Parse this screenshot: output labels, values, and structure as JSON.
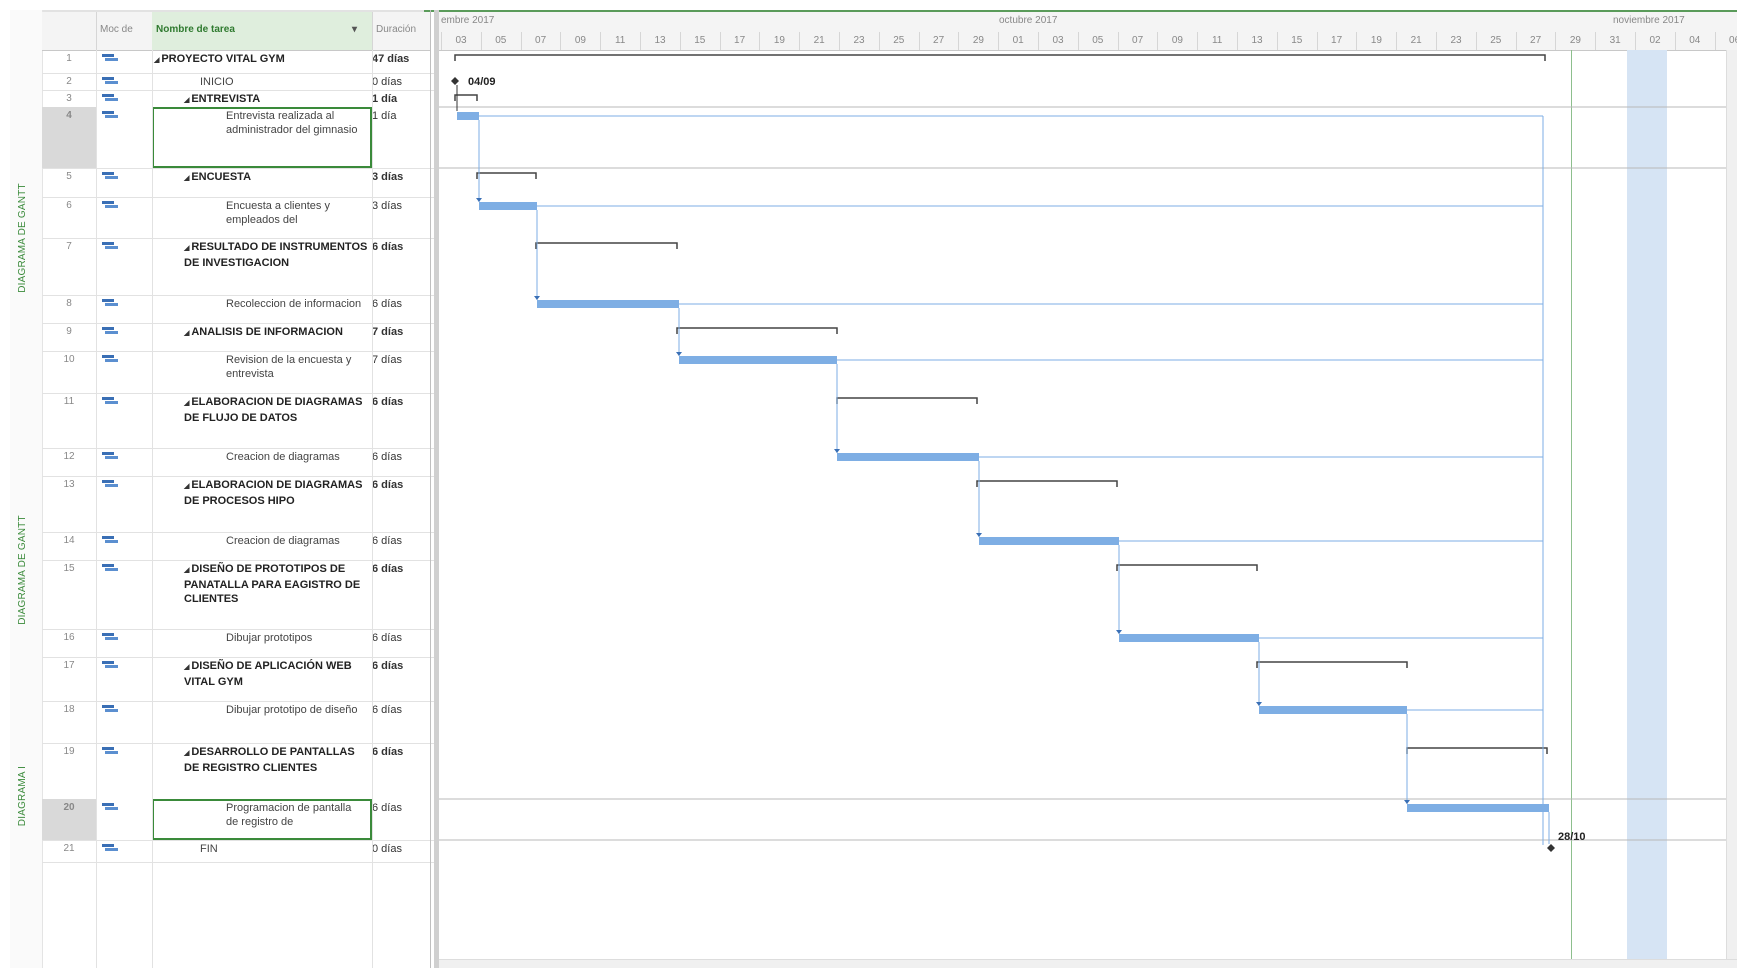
{
  "colors": {
    "accent": "#3a8a3a",
    "bar": "#7eaee4",
    "link": "#7eaee4",
    "highlight": "#d6e4f4"
  },
  "side_labels": [
    "DIAGRAMA DE GANTT",
    "DIAGRAMA DE GANTT",
    "DIAGRAMA I"
  ],
  "columns": {
    "mode": "Moc de",
    "name": "Nombre de tarea",
    "duration": "Duración"
  },
  "timescale": {
    "months": [
      "embre 2017",
      "octubre 2017",
      "noviembre 2017"
    ],
    "days": [
      "03",
      "05",
      "07",
      "09",
      "11",
      "13",
      "15",
      "17",
      "19",
      "21",
      "23",
      "25",
      "27",
      "29",
      "01",
      "03",
      "05",
      "07",
      "09",
      "11",
      "13",
      "15",
      "17",
      "19",
      "21",
      "23",
      "25",
      "27",
      "29",
      "31",
      "02",
      "04",
      "06"
    ]
  },
  "tasks": [
    {
      "id": "1",
      "name": "PROYECTO VITAL GYM",
      "duration": "47 días",
      "level": 0,
      "summary": true
    },
    {
      "id": "2",
      "name": "INICIO",
      "duration": "0 días",
      "level": 1,
      "summary": false
    },
    {
      "id": "3",
      "name": "ENTREVISTA",
      "duration": "1 día",
      "level": 1,
      "summary": true
    },
    {
      "id": "4",
      "name": "Entrevista realizada al administrador del gimnasio",
      "duration": "1 día",
      "level": 2,
      "summary": false,
      "selected": true
    },
    {
      "id": "5",
      "name": "ENCUESTA",
      "duration": "3 días",
      "level": 1,
      "summary": true
    },
    {
      "id": "6",
      "name": "Encuesta a clientes y empleados del",
      "duration": "3 días",
      "level": 2,
      "summary": false
    },
    {
      "id": "7",
      "name": "RESULTADO DE INSTRUMENTOS DE INVESTIGACION",
      "duration": "6 días",
      "level": 1,
      "summary": true
    },
    {
      "id": "8",
      "name": "Recoleccion de informacion",
      "duration": "6 días",
      "level": 2,
      "summary": false
    },
    {
      "id": "9",
      "name": "ANALISIS DE INFORMACION",
      "duration": "7 días",
      "level": 1,
      "summary": true
    },
    {
      "id": "10",
      "name": "Revision de la encuesta y entrevista",
      "duration": "7 días",
      "level": 2,
      "summary": false
    },
    {
      "id": "11",
      "name": "ELABORACION DE DIAGRAMAS DE FLUJO DE DATOS",
      "duration": "6 días",
      "level": 1,
      "summary": true
    },
    {
      "id": "12",
      "name": "Creacion de diagramas",
      "duration": "6 días",
      "level": 2,
      "summary": false
    },
    {
      "id": "13",
      "name": "ELABORACION DE DIAGRAMAS DE PROCESOS HIPO",
      "duration": "6 días",
      "level": 1,
      "summary": true
    },
    {
      "id": "14",
      "name": "Creacion de diagramas",
      "duration": "6 días",
      "level": 2,
      "summary": false
    },
    {
      "id": "15",
      "name": "DISEÑO DE PROTOTIPOS DE PANATALLA PARA EAGISTRO DE CLIENTES",
      "duration": "6 días",
      "level": 1,
      "summary": true
    },
    {
      "id": "16",
      "name": "Dibujar prototipos",
      "duration": "6 días",
      "level": 2,
      "summary": false
    },
    {
      "id": "17",
      "name": "DISEÑO DE APLICACIÓN WEB VITAL GYM",
      "duration": "6 días",
      "level": 1,
      "summary": true
    },
    {
      "id": "18",
      "name": "Dibujar prototipo de diseño",
      "duration": "6 días",
      "level": 2,
      "summary": false
    },
    {
      "id": "19",
      "name": "DESARROLLO DE PANTALLAS DE REGISTRO CLIENTES",
      "duration": "6 días",
      "level": 1,
      "summary": true
    },
    {
      "id": "20",
      "name": "Programacion de pantalla de registro de",
      "duration": "6 días",
      "level": 2,
      "summary": false,
      "selected": true
    },
    {
      "id": "21",
      "name": "FIN",
      "duration": "0 días",
      "level": 1,
      "summary": false
    }
  ],
  "milestones": {
    "start": "04/09",
    "end": "28/10"
  }
}
